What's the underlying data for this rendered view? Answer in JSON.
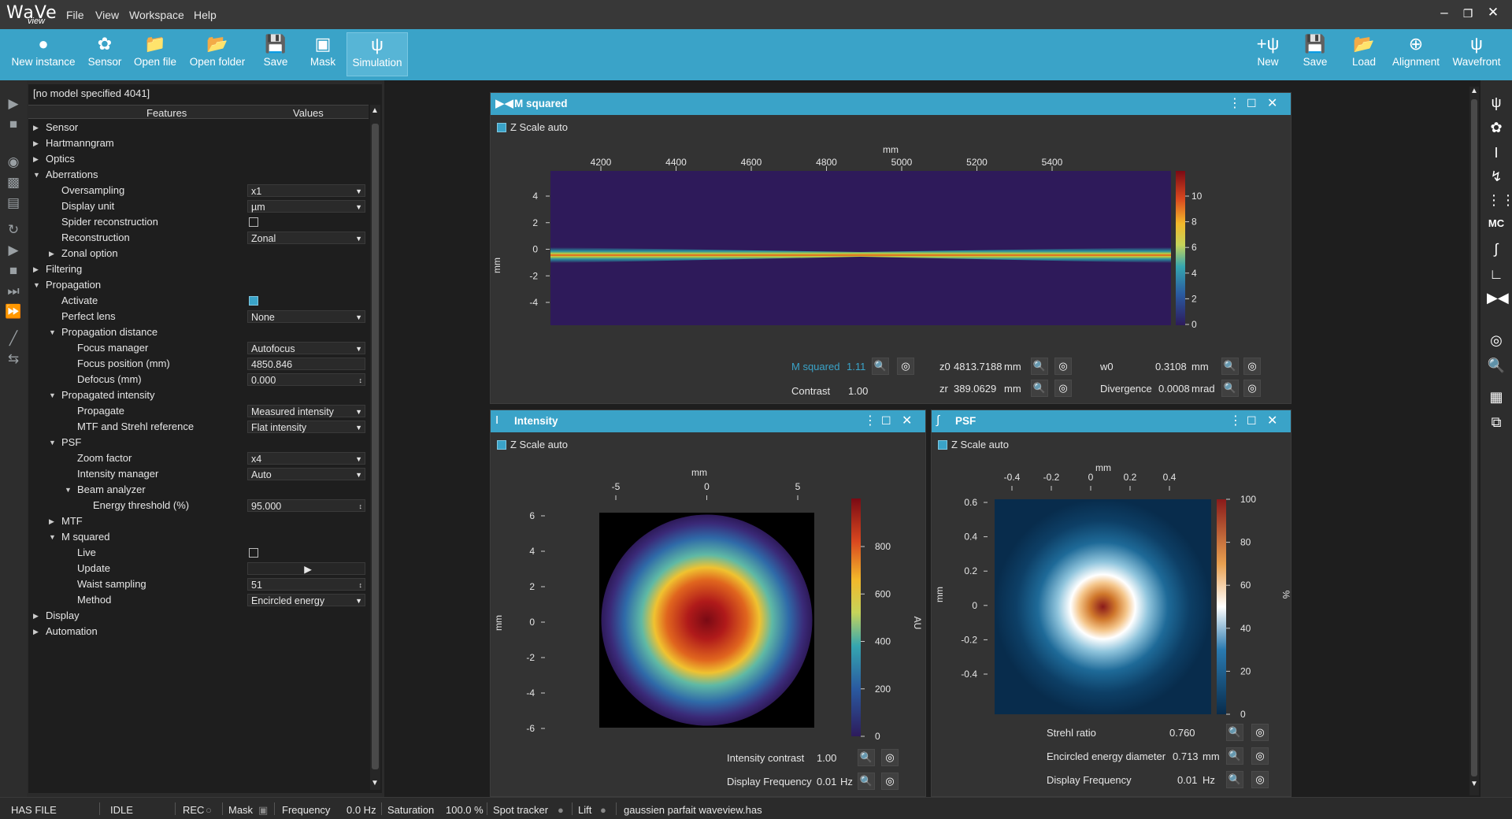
{
  "app": {
    "logo_word": "WaVe",
    "logo_sub": "view"
  },
  "menu": [
    "File",
    "View",
    "Workspace",
    "Help"
  ],
  "toolbar_left": [
    {
      "label": "New instance",
      "icon": "add-user-icon"
    },
    {
      "label": "Sensor",
      "icon": "aperture-icon"
    },
    {
      "label": "Open file",
      "icon": "folder-icon"
    },
    {
      "label": "Open folder",
      "icon": "folder-icon"
    },
    {
      "label": "Save",
      "icon": "floppy-icon"
    },
    {
      "label": "Mask",
      "icon": "crop-icon"
    },
    {
      "label": "Simulation",
      "icon": "psi-icon"
    }
  ],
  "toolbar_right": [
    {
      "label": "New",
      "icon": "new-wavefront-icon"
    },
    {
      "label": "Save",
      "icon": "floppy-icon"
    },
    {
      "label": "Load",
      "icon": "load-icon"
    },
    {
      "label": "Alignment",
      "icon": "alignment-icon"
    },
    {
      "label": "Wavefront",
      "icon": "wavefront-icon"
    }
  ],
  "panel": {
    "model": "[no model specified 4041]",
    "col_features": "Features",
    "col_values": "Values",
    "rows": [
      {
        "label": "Sensor",
        "indent": 0,
        "arrow": "right"
      },
      {
        "label": "Hartmanngram",
        "indent": 0,
        "arrow": "right"
      },
      {
        "label": "Optics",
        "indent": 0,
        "arrow": "right"
      },
      {
        "label": "Aberrations",
        "indent": 0,
        "arrow": "down"
      },
      {
        "label": "Oversampling",
        "indent": 1,
        "value": "x1",
        "kind": "dropdown"
      },
      {
        "label": "Display unit",
        "indent": 1,
        "value": "µm",
        "kind": "dropdown"
      },
      {
        "label": "Spider reconstruction",
        "indent": 1,
        "kind": "checkbox",
        "checked": false
      },
      {
        "label": "Reconstruction",
        "indent": 1,
        "value": "Zonal",
        "kind": "dropdown"
      },
      {
        "label": "Zonal option",
        "indent": 1,
        "arrow": "right"
      },
      {
        "label": "Filtering",
        "indent": 0,
        "arrow": "right"
      },
      {
        "label": "Propagation",
        "indent": 0,
        "arrow": "down"
      },
      {
        "label": "Activate",
        "indent": 1,
        "kind": "checkbox",
        "checked": true
      },
      {
        "label": "Perfect lens",
        "indent": 1,
        "value": "None",
        "kind": "dropdown"
      },
      {
        "label": "Propagation distance",
        "indent": 1,
        "arrow": "down"
      },
      {
        "label": "Focus manager",
        "indent": 2,
        "value": "Autofocus",
        "kind": "dropdown"
      },
      {
        "label": "Focus position (mm)",
        "indent": 2,
        "value": "4850.846",
        "kind": "text"
      },
      {
        "label": "Defocus (mm)",
        "indent": 2,
        "value": "0.000",
        "kind": "spin"
      },
      {
        "label": "Propagated intensity",
        "indent": 1,
        "arrow": "down"
      },
      {
        "label": "Propagate",
        "indent": 2,
        "value": "Measured intensity",
        "kind": "dropdown"
      },
      {
        "label": "MTF and Strehl reference",
        "indent": 2,
        "value": "Flat intensity",
        "kind": "dropdown"
      },
      {
        "label": "PSF",
        "indent": 1,
        "arrow": "down"
      },
      {
        "label": "Zoom factor",
        "indent": 2,
        "value": "x4",
        "kind": "dropdown"
      },
      {
        "label": "Intensity manager",
        "indent": 2,
        "value": "Auto",
        "kind": "dropdown"
      },
      {
        "label": "Beam analyzer",
        "indent": 2,
        "arrow": "down"
      },
      {
        "label": "Energy threshold (%)",
        "indent": 3,
        "value": "95.000",
        "kind": "spin"
      },
      {
        "label": "MTF",
        "indent": 1,
        "arrow": "right"
      },
      {
        "label": "M squared",
        "indent": 1,
        "arrow": "down"
      },
      {
        "label": "Live",
        "indent": 2,
        "kind": "checkbox",
        "checked": false
      },
      {
        "label": "Update",
        "indent": 2,
        "kind": "play"
      },
      {
        "label": "Waist sampling",
        "indent": 2,
        "value": "51",
        "kind": "spin"
      },
      {
        "label": "Method",
        "indent": 2,
        "value": "Encircled energy",
        "kind": "dropdown"
      },
      {
        "label": "Display",
        "indent": 0,
        "arrow": "right"
      },
      {
        "label": "Automation",
        "indent": 0,
        "arrow": "right"
      }
    ]
  },
  "msq": {
    "title": "M squared",
    "zscale": "Z Scale auto",
    "x_unit": "mm",
    "y_unit": "mm",
    "x_ticks": [
      "4200",
      "4400",
      "4600",
      "4800",
      "5000",
      "5200",
      "5400"
    ],
    "y_ticks": [
      "4",
      "2",
      "0",
      "-2",
      "-4"
    ],
    "cbar_ticks": [
      "10",
      "8",
      "6",
      "4",
      "2",
      "0"
    ],
    "m2_label": "M squared",
    "m2_value": "1.11",
    "contrast_label": "Contrast",
    "contrast_value": "1.00",
    "z0_label": "z0",
    "z0_value": "4813.7188",
    "z0_unit": "mm",
    "zr_label": "zr",
    "zr_value": "389.0629",
    "zr_unit": "mm",
    "w0_label": "w0",
    "w0_value": "0.3108",
    "w0_unit": "mm",
    "div_label": "Divergence",
    "div_value": "0.0008",
    "div_unit": "mrad"
  },
  "intensity": {
    "title": "Intensity",
    "zscale": "Z Scale auto",
    "x_unit": "mm",
    "y_unit": "mm",
    "cbar_unit": "AU",
    "x_ticks": [
      "-5",
      "0",
      "5"
    ],
    "y_ticks": [
      "6",
      "4",
      "2",
      "0",
      "-2",
      "-4",
      "-6"
    ],
    "cbar_ticks": [
      "800",
      "600",
      "400",
      "200",
      "0"
    ],
    "contrast_label": "Intensity contrast",
    "contrast_value": "1.00",
    "freq_label": "Display Frequency",
    "freq_value": "0.01",
    "freq_unit": "Hz"
  },
  "psf": {
    "title": "PSF",
    "zscale": "Z Scale auto",
    "x_unit": "mm",
    "y_unit": "mm",
    "cbar_unit": "%",
    "x_ticks": [
      "-0.4",
      "-0.2",
      "0",
      "0.2",
      "0.4"
    ],
    "y_ticks": [
      "0.6",
      "0.4",
      "0.2",
      "0",
      "-0.2",
      "-0.4"
    ],
    "cbar_ticks": [
      "100",
      "80",
      "60",
      "40",
      "20",
      "0"
    ],
    "strehl_label": "Strehl ratio",
    "strehl_value": "0.760",
    "eed_label": "Encircled energy diameter",
    "eed_value": "0.713",
    "eed_unit": "mm",
    "freq_label": "Display Frequency",
    "freq_value": "0.01",
    "freq_unit": "Hz"
  },
  "status": {
    "file": "HAS FILE",
    "state": "IDLE",
    "rec": "REC",
    "mask": "Mask",
    "freq_label": "Frequency",
    "freq_value": "0.0 Hz",
    "sat_label": "Saturation",
    "sat_value": "100.0 %",
    "spot": "Spot tracker",
    "lift": "Lift",
    "filename": "gaussien parfait waveview.has"
  },
  "colors": {
    "accent": "#3aa3c8",
    "background": "#1e1e1e"
  }
}
